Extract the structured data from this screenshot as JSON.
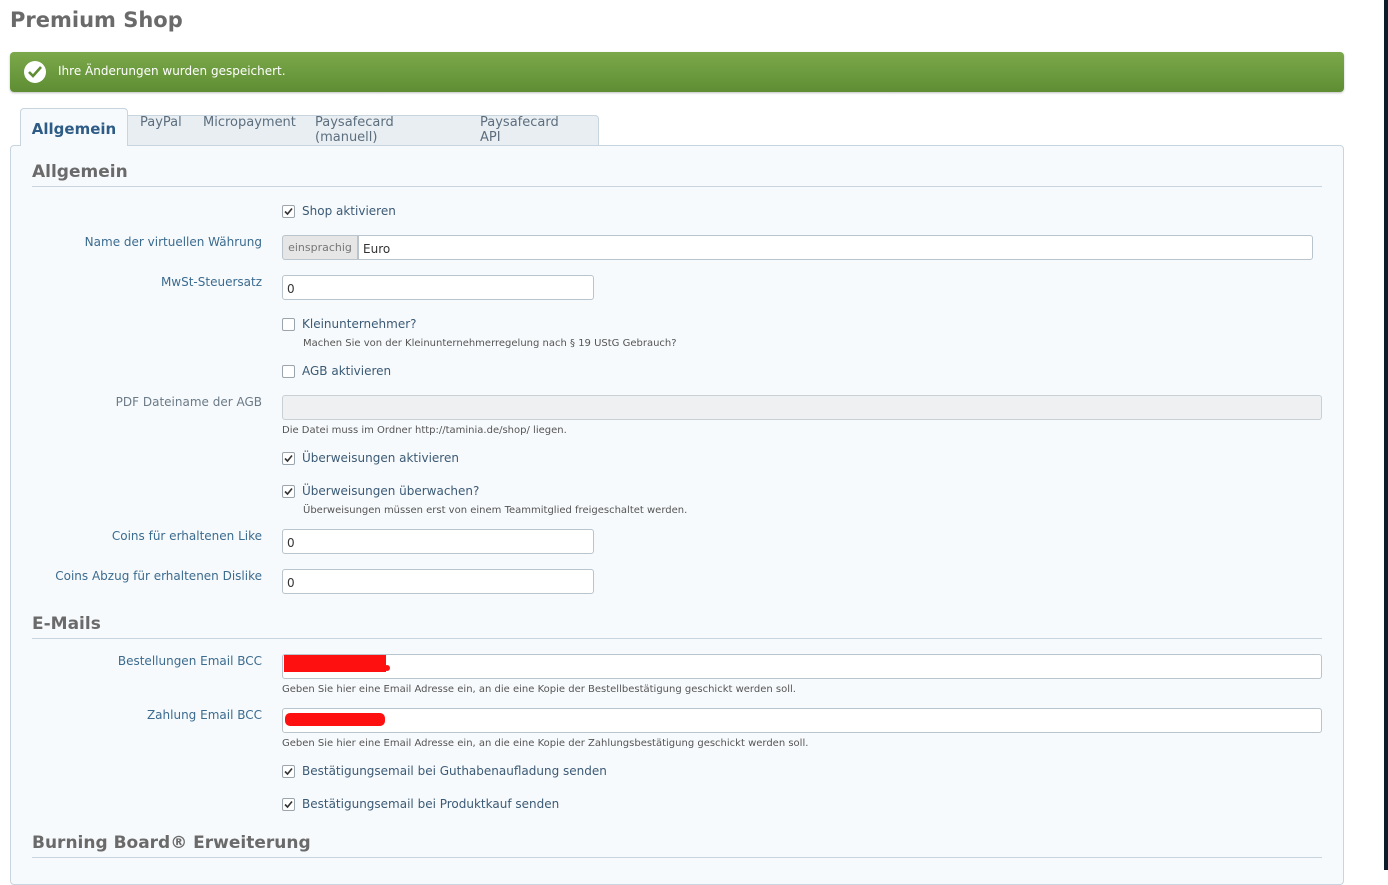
{
  "page_title": "Premium Shop",
  "notice": {
    "message": "Ihre Änderungen wurden gespeichert.",
    "color": "#6a9a3d"
  },
  "tabs": [
    {
      "label": "Allgemein",
      "active": true
    },
    {
      "label": "PayPal"
    },
    {
      "label": "Micropayment"
    },
    {
      "label": "Paysafecard (manuell)"
    },
    {
      "label": "Paysafecard API"
    }
  ],
  "sections": {
    "general": "Allgemein",
    "emails": "E-Mails",
    "burning_board": "Burning Board® Erweiterung"
  },
  "general": {
    "shop_active": {
      "label": "Shop aktivieren",
      "checked": true
    },
    "currency_name": {
      "label": "Name der virtuellen Währung",
      "addon": "einsprachig",
      "value": "Euro"
    },
    "vat_rate": {
      "label": "MwSt-Steuersatz",
      "value": "0"
    },
    "small_business": {
      "label": "Kleinunternehmer?",
      "checked": false,
      "hint": "Machen Sie von der Kleinunternehmerregelung nach § 19 UStG Gebrauch?"
    },
    "terms_active": {
      "label": "AGB aktivieren",
      "checked": false
    },
    "terms_pdf": {
      "label": "PDF Dateiname der AGB",
      "value": "",
      "hint": "Die Datei muss im Ordner http://taminia.de/shop/ liegen."
    },
    "transfers_active": {
      "label": "Überweisungen aktivieren",
      "checked": true
    },
    "transfers_monitor": {
      "label": "Überweisungen überwachen?",
      "checked": true,
      "hint": "Überweisungen müssen erst von einem Teammitglied freigeschaltet werden."
    },
    "coins_like": {
      "label": "Coins für erhaltenen Like",
      "value": "0"
    },
    "coins_dislike": {
      "label": "Coins Abzug für erhaltenen Dislike",
      "value": "0"
    }
  },
  "emails": {
    "order_bcc": {
      "label": "Bestellungen Email BCC",
      "hint": "Geben Sie hier eine Email Adresse ein, an die eine Kopie der Bestellbestätigung geschickt werden soll."
    },
    "payment_bcc": {
      "label": "Zahlung Email BCC",
      "hint": "Geben Sie hier eine Email Adresse ein, an die eine Kopie der Zahlungsbestätigung geschickt werden soll."
    },
    "confirm_topup": {
      "label": "Bestätigungsemail bei Guthabenaufladung senden",
      "checked": true
    },
    "confirm_purchase": {
      "label": "Bestätigungsemail bei Produktkauf senden",
      "checked": true
    }
  }
}
